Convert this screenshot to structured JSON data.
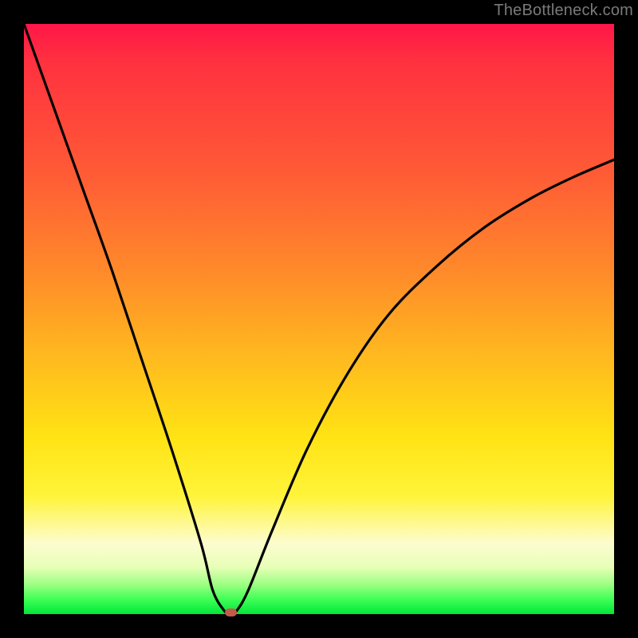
{
  "watermark": "TheBottleneck.com",
  "chart_data": {
    "type": "line",
    "title": "",
    "xlabel": "",
    "ylabel": "",
    "xlim": [
      0,
      100
    ],
    "ylim": [
      0,
      100
    ],
    "grid": false,
    "legend": false,
    "series": [
      {
        "name": "bottleneck-curve",
        "x": [
          0,
          5,
          10,
          15,
          20,
          25,
          30,
          32,
          34,
          35,
          36,
          38,
          42,
          48,
          55,
          62,
          70,
          78,
          86,
          93,
          100
        ],
        "values": [
          100,
          86,
          72,
          58,
          43,
          28,
          12,
          4,
          0.5,
          0,
          0.5,
          4,
          14,
          28,
          41,
          51,
          59,
          65.5,
          70.5,
          74,
          77
        ]
      }
    ],
    "marker": {
      "x": 35,
      "y": 0,
      "color": "#c45a4a"
    },
    "background_gradient": {
      "top": "#ff1648",
      "mid_upper": "#ff8a2a",
      "mid": "#ffe314",
      "mid_lower": "#fdfccf",
      "bottom": "#00e63a"
    }
  }
}
